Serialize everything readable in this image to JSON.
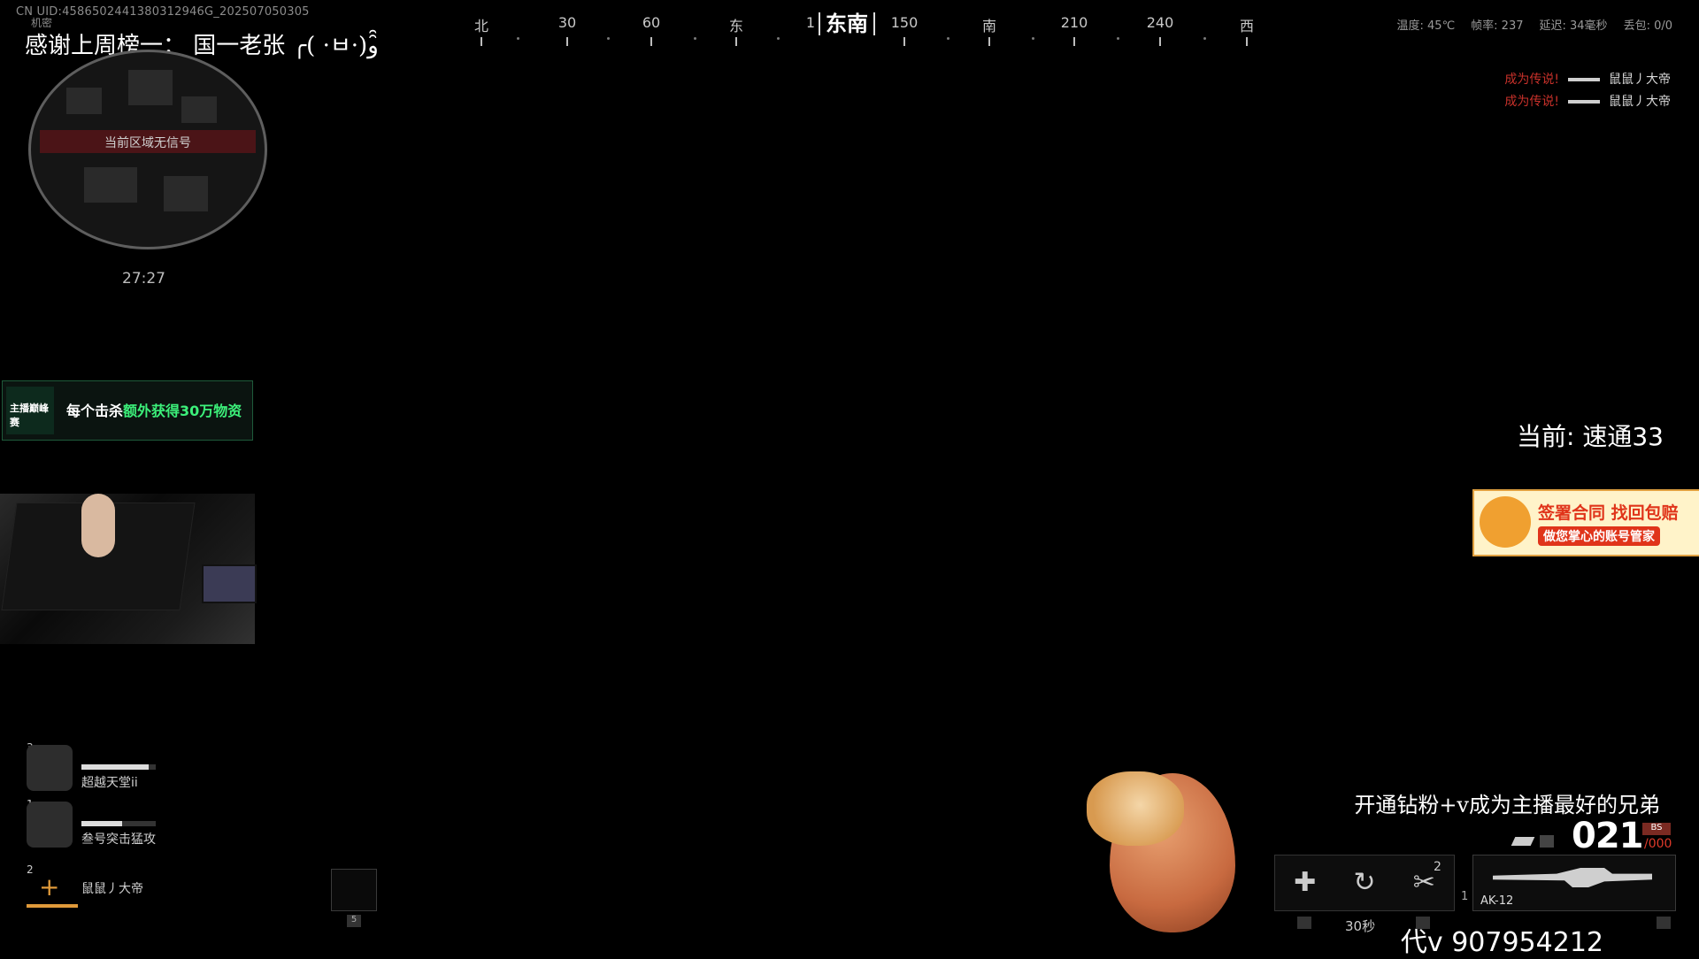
{
  "top": {
    "uid": "CN UID:4586502441380312946G_202507050305",
    "secret": "机密",
    "thanks": "感谢上周榜一：  国一老张 ╭( ·ㅂ·)و ̑̑"
  },
  "compass": {
    "labels": [
      "北",
      "30",
      "60",
      "东",
      "1",
      "150",
      "南",
      "210",
      "240",
      "西"
    ],
    "current": "东南"
  },
  "stats": {
    "temp": "温度: 45℃",
    "fps": "帧率: 237",
    "latency": "延迟: 34毫秒",
    "loss": "丢包: 0/0"
  },
  "minimap": {
    "no_signal": "当前区域无信号",
    "time": "27:27"
  },
  "promo": {
    "logo": "主播巅峰赛",
    "text_a": "每个击杀",
    "text_b": "额外获得30万物资"
  },
  "current_mode": "当前: 速通33",
  "ad": {
    "title": "签署合同 找回包赔",
    "sub": "做您掌心的账号管家"
  },
  "killfeed": [
    {
      "event": "成为传说!",
      "player": "鼠鼠丿大帝"
    },
    {
      "event": "成为传说!",
      "player": "鼠鼠丿大帝"
    }
  ],
  "squad": [
    {
      "num": "3",
      "name": "超越天堂ii",
      "health": 0.9
    },
    {
      "num": "1",
      "name": "叁号突击猛攻",
      "health": 0.55
    }
  ],
  "squad_self": {
    "num": "2",
    "name": "鼠鼠丿大帝"
  },
  "slot_key": "5",
  "subtitle": "开通钻粉+v成为主播最好的兄弟",
  "watermark": "代v 907954212",
  "weapon": {
    "ammo": "021",
    "reserve": "/000",
    "badge": "BS",
    "tool_count": "2",
    "timer": "30秒",
    "slot_num": "1",
    "name": "AK-12"
  },
  "colors": {
    "promo_highlight": "#3cf07a",
    "killfeed_event": "#c8312a",
    "squad_accent": "#e09a3a"
  }
}
